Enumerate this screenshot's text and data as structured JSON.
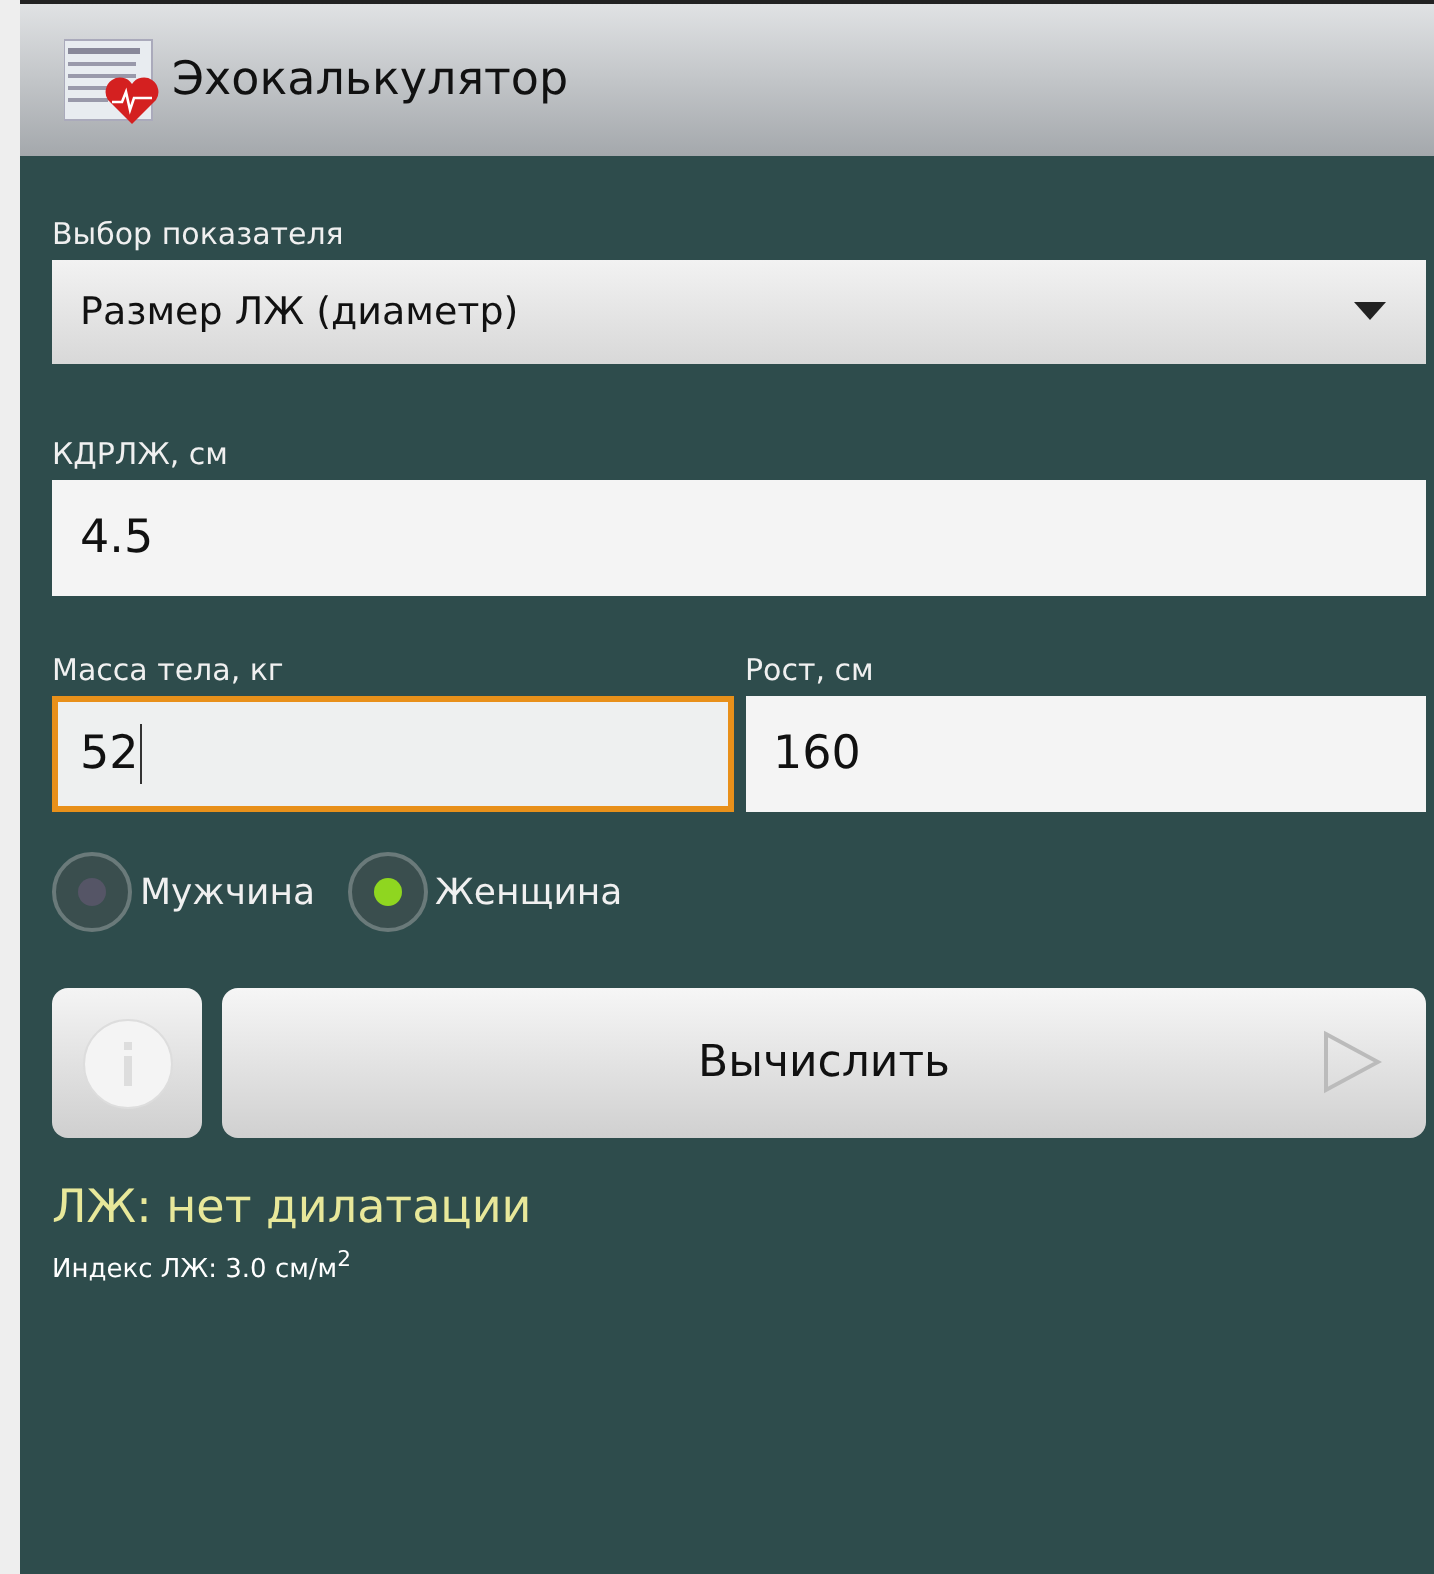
{
  "window": {
    "title": "Эхокалькулятор"
  },
  "selector": {
    "label": "Выбор показателя",
    "value": "Размер ЛЖ (диаметр)"
  },
  "fields": [
    {
      "label": "КДРЛЖ, см",
      "value": "4.5",
      "focused": false,
      "kind": "full"
    },
    {
      "label": "Масса тела, кг",
      "value": "52",
      "focused": true,
      "kind": "half"
    },
    {
      "label": "Рост, см",
      "value": "160",
      "focused": false,
      "kind": "half"
    }
  ],
  "sex": [
    {
      "label": "Мужчина",
      "selected": false
    },
    {
      "label": "Женщина",
      "selected": true
    }
  ],
  "calculate_button": {
    "label": "Вычислить"
  },
  "result": {
    "verdict": "ЛЖ: нет дилатации",
    "index": "Индекс ЛЖ: 3.0 см/м$^{2}$"
  }
}
